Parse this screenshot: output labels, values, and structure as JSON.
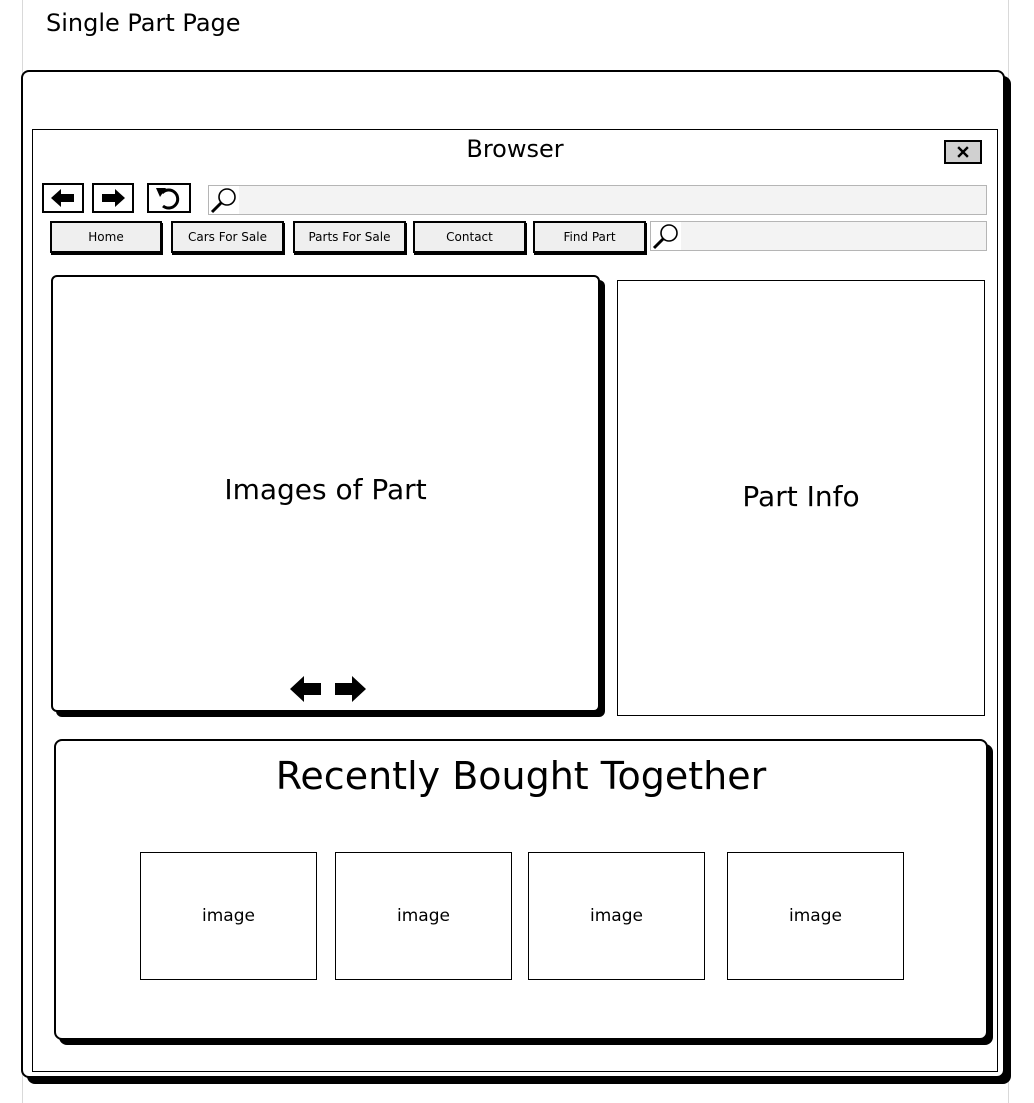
{
  "page": {
    "title": "Single Part Page"
  },
  "browser": {
    "title": "Browser",
    "close_glyph": "×",
    "icons": [
      "back-arrow-icon",
      "forward-arrow-icon",
      "refresh-icon",
      "search-icon",
      "close-icon"
    ]
  },
  "menu": {
    "items": [
      {
        "label": "Home"
      },
      {
        "label": "Cars For Sale"
      },
      {
        "label": "Parts For Sale"
      },
      {
        "label": "Contact"
      },
      {
        "label": "Find Part"
      }
    ]
  },
  "images_panel": {
    "label": "Images of Part"
  },
  "info_panel": {
    "label": "Part Info"
  },
  "recent": {
    "title": "Recently Bought Together",
    "items": [
      {
        "label": "image"
      },
      {
        "label": "image"
      },
      {
        "label": "image"
      },
      {
        "label": "image"
      }
    ]
  }
}
